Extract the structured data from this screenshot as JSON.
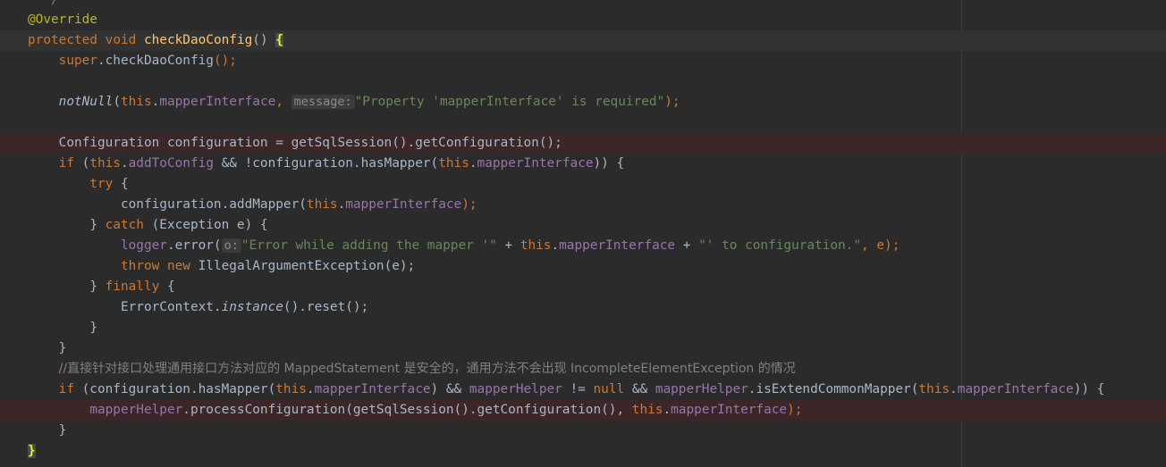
{
  "editor": {
    "lines": {
      "l0": "  */",
      "l1_annotation": "@Override",
      "l2": {
        "kw1": "protected",
        "kw2": "void",
        "method": "checkDaoConfig",
        "parens": "()",
        "space": " ",
        "brace": "{"
      },
      "l3": {
        "kw": "super",
        "rest": ".checkDaoConfig",
        "end": "();"
      },
      "l5": {
        "method": "notNull",
        "open": "(",
        "this": "this",
        "dot": ".",
        "field": "mapperInterface",
        "comma": ", ",
        "hint": "message:",
        "str": "\"Property 'mapperInterface' is required\"",
        "end": ");"
      },
      "l7": {
        "text": "Configuration configuration = getSqlSession().getConfiguration();"
      },
      "l8": {
        "kw_if": "if",
        "p1": " (",
        "this1": "this",
        "dot1": ".",
        "field1": "addToConfig",
        "mid": " && !configuration.hasMapper(",
        "this2": "this",
        "dot2": ".",
        "field2": "mapperInterface",
        "end": ")) {"
      },
      "l9": {
        "kw": "try",
        "end": " {"
      },
      "l10": {
        "pre": "configuration.addMapper(",
        "this": "this",
        "dot": ".",
        "field": "mapperInterface",
        "end": ");"
      },
      "l11": {
        "pre": "} ",
        "kw": "catch",
        "end": " (Exception e) {"
      },
      "l12": {
        "field": "logger",
        "mid": ".error(",
        "hint": "o:",
        "str1": "\"Error while adding the mapper '\"",
        "plus1": " + ",
        "this": "this",
        "dot": ".",
        "field2": "mapperInterface",
        "plus2": " + ",
        "str2": "\"' to configuration.\"",
        "end": ", e);"
      },
      "l13": {
        "kw1": "throw",
        "kw2": "new",
        "rest": " IllegalArgumentException(e);"
      },
      "l14": {
        "pre": "} ",
        "kw": "finally",
        "end": " {"
      },
      "l15": {
        "cls": "ErrorContext.",
        "method": "instance",
        "end": "().reset();"
      },
      "l16": "}",
      "l17": "}",
      "l18_comment": "//直接针对接口处理通用接口方法对应的 MappedStatement 是安全的，通用方法不会出现 IncompleteElementException 的情况",
      "l19": {
        "kw_if": "if",
        "p1": " (configuration.hasMapper(",
        "this1": "this",
        "dot1": ".",
        "field1": "mapperInterface",
        "and1": ") && ",
        "field2": "mapperHelper",
        "neq": " != ",
        "kw_null": "null",
        "and2": " && ",
        "field3": "mapperHelper",
        "call": ".isExtendCommonMapper(",
        "this2": "this",
        "dot2": ".",
        "field4": "mapperInterface",
        "end": ")) {"
      },
      "l20": {
        "field": "mapperHelper",
        "call": ".processConfiguration(getSqlSession().getConfiguration(), ",
        "this": "this",
        "dot": ".",
        "field2": "mapperInterface",
        "end": ");"
      },
      "l21": "}",
      "l22": "}"
    }
  }
}
